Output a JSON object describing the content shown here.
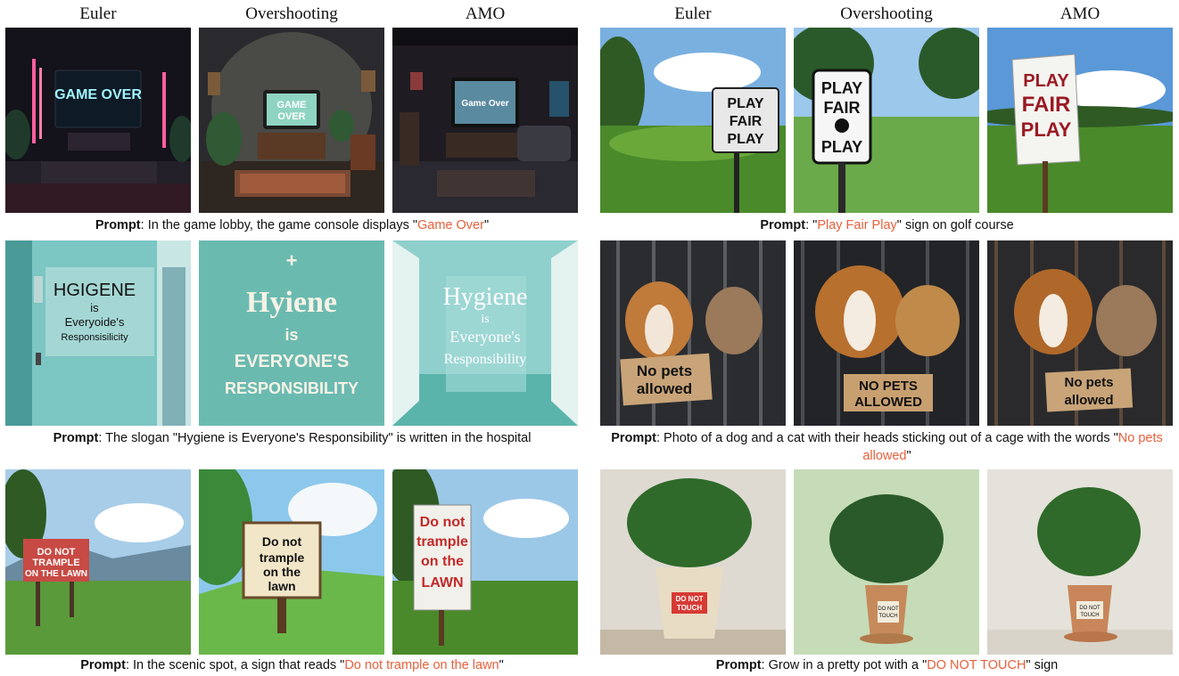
{
  "column_headers": [
    "Euler",
    "Overshooting",
    "AMO"
  ],
  "prompt_label": "Prompt",
  "panels": [
    {
      "rows": [
        {
          "prompt_text": "In the game lobby, the game console displays \"",
          "prompt_highlight": "Game Over",
          "prompt_suffix": "\"",
          "sign_texts": [
            "GAME OVER",
            "GAME OVER",
            "Game Over"
          ]
        },
        {
          "prompt_text": "The slogan \"Hygiene is Everyone's Responsibility\" is written in the hospital",
          "prompt_highlight": "",
          "prompt_suffix": "",
          "sign_texts": [
            [
              "HGIGENE",
              "is",
              "Everyoide's",
              "Responsisilicity"
            ],
            [
              "Hyiene",
              "is",
              "EVERYONE'S",
              "RESPONSIBILITY"
            ],
            [
              "Hygiene",
              "is",
              "Everyone's",
              "Responsibility"
            ]
          ]
        },
        {
          "prompt_text": "In the scenic spot, a sign that reads \"",
          "prompt_highlight": "Do not trample on the lawn",
          "prompt_suffix": "\"",
          "sign_texts": [
            [
              "DO NOT",
              "TRAMPLE",
              "ON THE LAWN"
            ],
            [
              "Do not",
              "trample",
              "on the",
              "lawn"
            ],
            [
              "Do not",
              "trample",
              "on the",
              "LAWN"
            ]
          ]
        }
      ]
    },
    {
      "rows": [
        {
          "prompt_text": "\"",
          "prompt_highlight": "Play Fair Play",
          "prompt_suffix": "\" sign on golf course",
          "sign_texts": [
            [
              "PLAY",
              "FAIR",
              "PLAY"
            ],
            [
              "PLAY",
              "FAIR",
              "PLAY"
            ],
            [
              "PLAY",
              "FAIR",
              "PLAY"
            ]
          ]
        },
        {
          "prompt_text": "Photo of a dog and a cat with their heads sticking out of a cage with the words \"",
          "prompt_highlight": "No pets allowed",
          "prompt_suffix": "\"",
          "sign_texts": [
            [
              "No pets",
              "allowed"
            ],
            [
              "NO PETS",
              "ALLOWED"
            ],
            [
              "No pets",
              "allowed"
            ]
          ]
        },
        {
          "prompt_text": "Grow in a pretty pot with a \"",
          "prompt_highlight": "DO NOT TOUCH",
          "prompt_suffix": "\" sign",
          "sign_texts": [
            [
              "DO NOT",
              "TOUCH"
            ],
            [
              "DO NOT",
              "TOUCH"
            ],
            [
              "DO NOT",
              "TOUCH"
            ]
          ]
        }
      ]
    }
  ]
}
